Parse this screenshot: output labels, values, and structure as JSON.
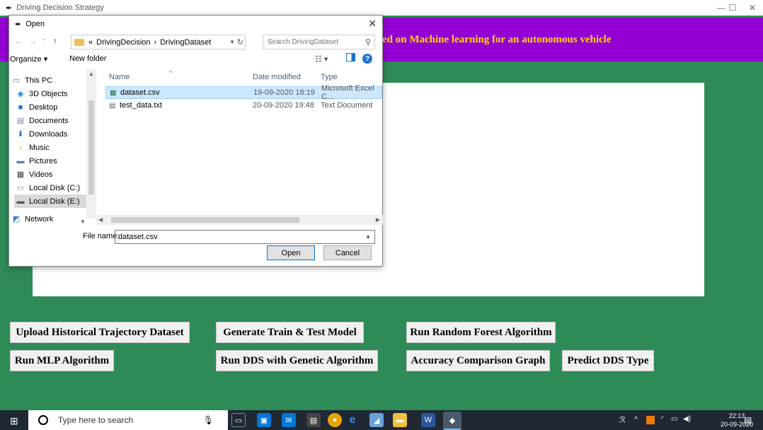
{
  "window": {
    "title": "Driving Decision Strategy",
    "minimize": "—",
    "maximize": "☐",
    "close": "✕"
  },
  "app": {
    "title_visible": "ed on Machine learning for an autonomous vehicle",
    "header_color": "#9400d3",
    "background_color": "#2e8b57",
    "title_color": "#ffd700"
  },
  "buttons": {
    "upload": "Upload Historical Trajectory Dataset",
    "generate": "Generate Train & Test Model",
    "random_forest": "Run Random Forest Algorithm",
    "mlp": "Run MLP Algorithm",
    "dds_genetic": "Run DDS with Genetic Algorithm",
    "accuracy_graph": "Accuracy Comparison Graph",
    "predict": "Predict DDS Type"
  },
  "dialog": {
    "title": "Open",
    "close": "✕",
    "nav": {
      "back": "←",
      "forward": "→",
      "dropdown": "⌄",
      "up": "↑"
    },
    "breadcrumb": [
      "«",
      "DrivingDecision",
      "›",
      "DrivingDataset"
    ],
    "search_placeholder": "Search DrivingDataset",
    "organize": "Organize ▾",
    "new_folder": "New folder",
    "view_icon": "☷ ▾",
    "help": "?",
    "sidebar": [
      {
        "label": "This PC",
        "icon": "computer-icon"
      },
      {
        "label": "3D Objects",
        "icon": "cube-icon"
      },
      {
        "label": "Desktop",
        "icon": "desktop-icon"
      },
      {
        "label": "Documents",
        "icon": "documents-icon"
      },
      {
        "label": "Downloads",
        "icon": "download-icon"
      },
      {
        "label": "Music",
        "icon": "music-icon"
      },
      {
        "label": "Pictures",
        "icon": "pictures-icon"
      },
      {
        "label": "Videos",
        "icon": "videos-icon"
      },
      {
        "label": "Local Disk (C:)",
        "icon": "drive-icon"
      },
      {
        "label": "Local Disk (E:)",
        "icon": "drive-icon"
      },
      {
        "label": "Network",
        "icon": "network-icon"
      }
    ],
    "columns": {
      "name": "Name",
      "date": "Date modified",
      "type": "Type"
    },
    "files": [
      {
        "name": "dataset.csv",
        "date": "19-09-2020 18:19",
        "type": "Microsoft Excel C...",
        "selected": true
      },
      {
        "name": "test_data.txt",
        "date": "20-09-2020 19:48",
        "type": "Text Document",
        "selected": false
      }
    ],
    "file_name_label": "File name:",
    "file_name_value": "dataset.csv",
    "open": "Open",
    "cancel": "Cancel"
  },
  "taskbar": {
    "search_placeholder": "Type here to search",
    "time": "22:13",
    "date": "20-09-2020"
  }
}
